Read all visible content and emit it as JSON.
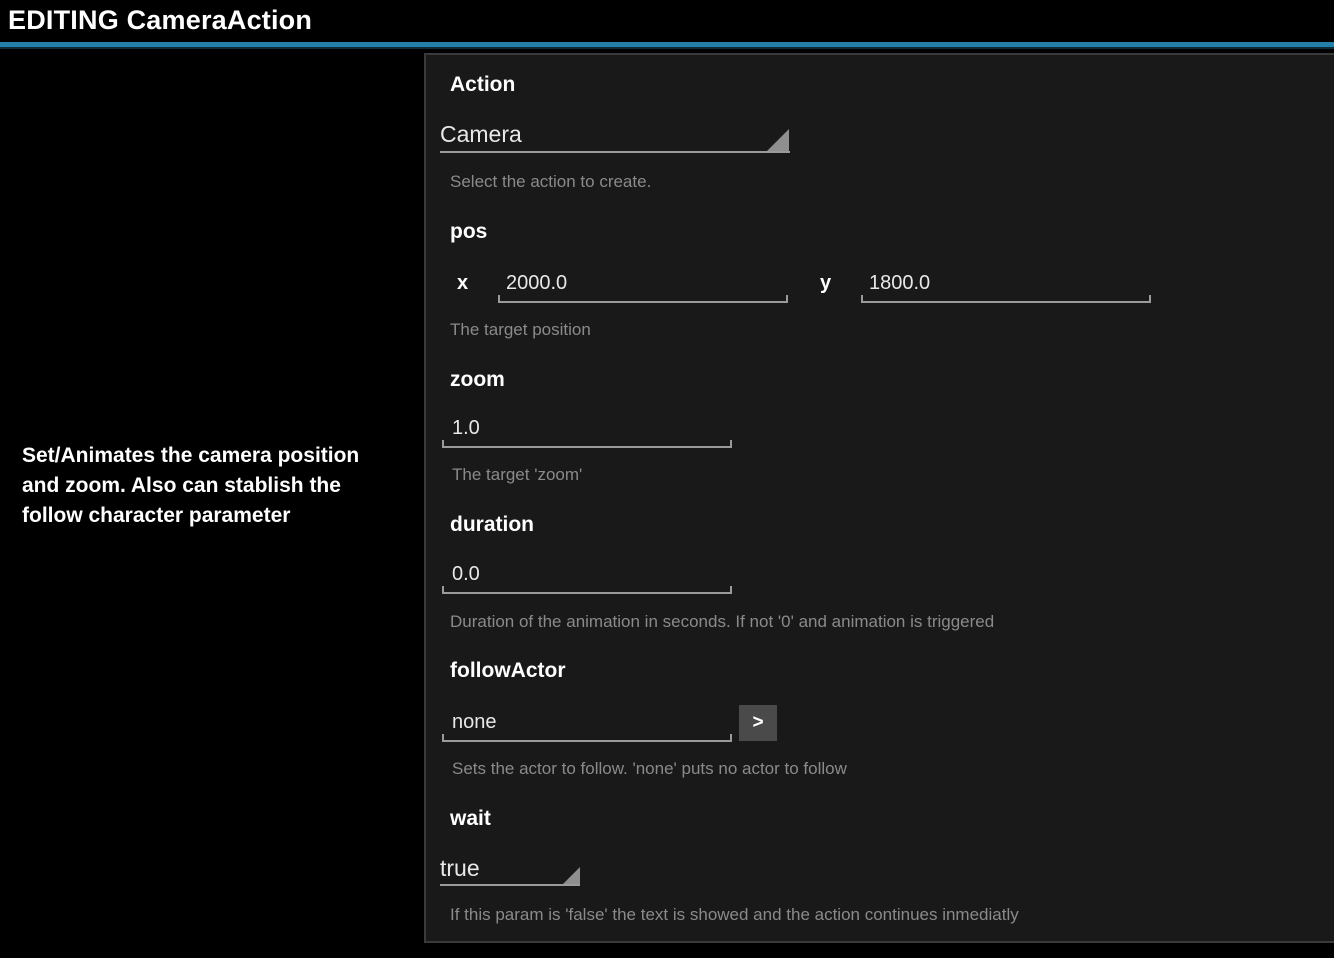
{
  "window": {
    "title": "EDITING CameraAction",
    "accent_color": "#2380A8",
    "background_color": "#000000",
    "panel_color": "#191919"
  },
  "description_panel": {
    "text": "Set/Animates the camera position and zoom. Also can stablish the follow character parameter"
  },
  "form": {
    "action": {
      "label": "Action",
      "value": "Camera",
      "help": "Select the action to create."
    },
    "pos": {
      "label": "pos",
      "x_label": "x",
      "x_value": "2000.0",
      "y_label": "y",
      "y_value": "1800.0",
      "help": "The target position"
    },
    "zoom": {
      "label": "zoom",
      "value": "1.0",
      "help": "The target 'zoom'"
    },
    "duration": {
      "label": "duration",
      "value": "0.0",
      "help": "Duration of the animation in seconds. If not '0' and animation is triggered"
    },
    "follow_actor": {
      "label": "followActor",
      "value": "none",
      "picker_label": ">",
      "help": "Sets the actor to follow. 'none' puts no actor to follow"
    },
    "wait": {
      "label": "wait",
      "value": "true",
      "help": "If this param is 'false' the text is showed and the action continues inmediatly"
    }
  }
}
